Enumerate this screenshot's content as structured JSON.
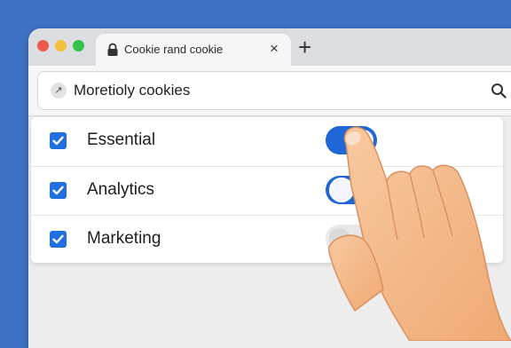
{
  "tab": {
    "title": "Cookie rand cookie",
    "close": "×"
  },
  "new_tab": "+",
  "address": {
    "text": "Moretioly cookies"
  },
  "cookies": [
    {
      "label": "Essential",
      "checked": true,
      "toggle": "on"
    },
    {
      "label": "Analytics",
      "checked": true,
      "toggle": "on"
    },
    {
      "label": "Marketing",
      "checked": true,
      "toggle": "off"
    }
  ],
  "colors": {
    "desktop": "#3f71c4",
    "accent": "#1f66d6",
    "checkbox": "#1f6fe0"
  },
  "icons": [
    "lock-icon",
    "site-icon",
    "search-icon",
    "check-icon",
    "pointing-hand"
  ]
}
